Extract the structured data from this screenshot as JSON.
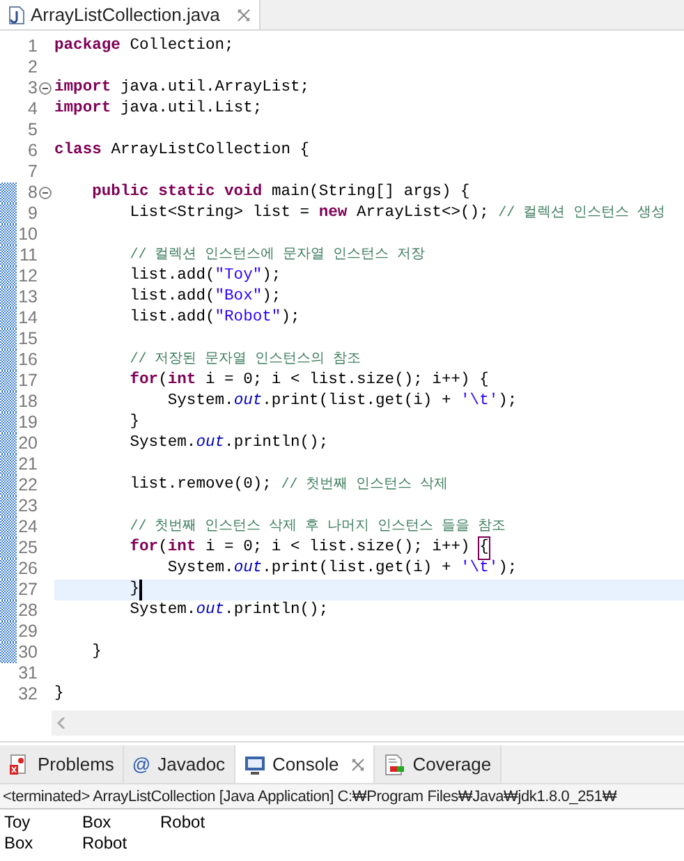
{
  "editor_tab": {
    "title": "ArrayListCollection.java",
    "selected": true
  },
  "lines": [
    {
      "number": "1",
      "fold": false,
      "changed": false,
      "current": false,
      "segments": [
        {
          "kind": "kw",
          "text": "package "
        },
        {
          "kind": "txt",
          "text": "Collection;"
        }
      ]
    },
    {
      "number": "2",
      "fold": false,
      "changed": false,
      "current": false
    },
    {
      "number": "3",
      "fold": true,
      "changed": false,
      "current": false,
      "segments": [
        {
          "kind": "kw",
          "text": "import "
        },
        {
          "kind": "txt",
          "text": "java.util.ArrayList;"
        }
      ]
    },
    {
      "number": "4",
      "fold": false,
      "changed": false,
      "current": false,
      "segments": [
        {
          "kind": "kw",
          "text": "import "
        },
        {
          "kind": "txt",
          "text": "java.util.List;"
        }
      ]
    },
    {
      "number": "5",
      "fold": false,
      "changed": false,
      "current": false
    },
    {
      "number": "6",
      "fold": false,
      "changed": false,
      "current": false,
      "segments": [
        {
          "kind": "kw",
          "text": "class "
        },
        {
          "kind": "txt",
          "text": "ArrayListCollection {"
        }
      ]
    },
    {
      "number": "7",
      "fold": false,
      "changed": false,
      "current": false
    },
    {
      "number": "8",
      "fold": true,
      "changed": true,
      "current": false,
      "segments": [
        {
          "kind": "kw",
          "text": "    public static void "
        },
        {
          "kind": "txt",
          "text": "main(String[] args) {"
        }
      ]
    },
    {
      "number": "9",
      "fold": false,
      "changed": true,
      "current": false,
      "segments": [
        {
          "kind": "txt",
          "text": "        List<String> list = "
        },
        {
          "kind": "kw",
          "text": "new "
        },
        {
          "kind": "txt",
          "text": "ArrayList<>(); "
        },
        {
          "kind": "com",
          "text": "// 컬렉션 인스턴스 생성"
        }
      ]
    },
    {
      "number": "10",
      "fold": false,
      "changed": true,
      "current": false
    },
    {
      "number": "11",
      "fold": false,
      "changed": true,
      "current": false,
      "segments": [
        {
          "kind": "com",
          "text": "        // 컬렉션 인스턴스에 문자열 인스턴스 저장"
        }
      ]
    },
    {
      "number": "12",
      "fold": false,
      "changed": true,
      "current": false,
      "segments": [
        {
          "kind": "txt",
          "text": "        list.add("
        },
        {
          "kind": "str",
          "text": "\"Toy\""
        },
        {
          "kind": "txt",
          "text": ");"
        }
      ]
    },
    {
      "number": "13",
      "fold": false,
      "changed": true,
      "current": false,
      "segments": [
        {
          "kind": "txt",
          "text": "        list.add("
        },
        {
          "kind": "str",
          "text": "\"Box\""
        },
        {
          "kind": "txt",
          "text": ");"
        }
      ]
    },
    {
      "number": "14",
      "fold": false,
      "changed": true,
      "current": false,
      "segments": [
        {
          "kind": "txt",
          "text": "        list.add("
        },
        {
          "kind": "str",
          "text": "\"Robot\""
        },
        {
          "kind": "txt",
          "text": ");"
        }
      ]
    },
    {
      "number": "15",
      "fold": false,
      "changed": true,
      "current": false
    },
    {
      "number": "16",
      "fold": false,
      "changed": true,
      "current": false,
      "segments": [
        {
          "kind": "com",
          "text": "        // 저장된 문자열 인스턴스의 참조"
        }
      ]
    },
    {
      "number": "17",
      "fold": false,
      "changed": true,
      "current": false,
      "segments": [
        {
          "kind": "kw",
          "text": "        for"
        },
        {
          "kind": "txt",
          "text": "("
        },
        {
          "kind": "kw",
          "text": "int"
        },
        {
          "kind": "txt",
          "text": " i = 0; i < list.size(); i++) {"
        }
      ]
    },
    {
      "number": "18",
      "fold": false,
      "changed": true,
      "current": false,
      "segments": [
        {
          "kind": "txt",
          "text": "            System."
        },
        {
          "kind": "fld",
          "text": "out"
        },
        {
          "kind": "txt",
          "text": ".print(list.get(i) + "
        },
        {
          "kind": "str",
          "text": "'\\t'"
        },
        {
          "kind": "txt",
          "text": ");"
        }
      ]
    },
    {
      "number": "19",
      "fold": false,
      "changed": true,
      "current": false,
      "segments": [
        {
          "kind": "txt",
          "text": "        }"
        }
      ]
    },
    {
      "number": "20",
      "fold": false,
      "changed": true,
      "current": false,
      "segments": [
        {
          "kind": "txt",
          "text": "        System."
        },
        {
          "kind": "fld",
          "text": "out"
        },
        {
          "kind": "txt",
          "text": ".println();"
        }
      ]
    },
    {
      "number": "21",
      "fold": false,
      "changed": true,
      "current": false
    },
    {
      "number": "22",
      "fold": false,
      "changed": true,
      "current": false,
      "segments": [
        {
          "kind": "txt",
          "text": "        list.remove(0); "
        },
        {
          "kind": "com",
          "text": "// 첫번째 인스턴스 삭제"
        }
      ]
    },
    {
      "number": "23",
      "fold": false,
      "changed": true,
      "current": false
    },
    {
      "number": "24",
      "fold": false,
      "changed": true,
      "current": false,
      "segments": [
        {
          "kind": "com",
          "text": "        // 첫번째 인스턴스 삭제 후 나머지 인스턴스 들을 참조"
        }
      ]
    },
    {
      "number": "25",
      "fold": false,
      "changed": true,
      "current": false,
      "segments": [
        {
          "kind": "kw",
          "text": "        for"
        },
        {
          "kind": "txt",
          "text": "("
        },
        {
          "kind": "kw",
          "text": "int"
        },
        {
          "kind": "txt",
          "text": " i = 0; i < list.size(); i++) "
        },
        {
          "kind": "match",
          "text": "{"
        }
      ]
    },
    {
      "number": "26",
      "fold": false,
      "changed": true,
      "current": false,
      "segments": [
        {
          "kind": "txt",
          "text": "            System."
        },
        {
          "kind": "fld",
          "text": "out"
        },
        {
          "kind": "txt",
          "text": ".print(list.get(i) + "
        },
        {
          "kind": "str",
          "text": "'\\t'"
        },
        {
          "kind": "txt",
          "text": ");"
        }
      ]
    },
    {
      "number": "27",
      "fold": false,
      "changed": true,
      "current": true,
      "segments": [
        {
          "kind": "txt",
          "text": "        }"
        }
      ]
    },
    {
      "number": "28",
      "fold": false,
      "changed": true,
      "current": false,
      "segments": [
        {
          "kind": "txt",
          "text": "        System."
        },
        {
          "kind": "fld",
          "text": "out"
        },
        {
          "kind": "txt",
          "text": ".println();"
        }
      ]
    },
    {
      "number": "29",
      "fold": false,
      "changed": true,
      "current": false
    },
    {
      "number": "30",
      "fold": false,
      "changed": true,
      "current": false,
      "segments": [
        {
          "kind": "txt",
          "text": "    }"
        }
      ]
    },
    {
      "number": "31",
      "fold": false,
      "changed": false,
      "current": false
    },
    {
      "number": "32",
      "fold": false,
      "changed": false,
      "current": false,
      "segments": [
        {
          "kind": "txt",
          "text": "}"
        }
      ]
    }
  ],
  "bottom_tabs": [
    {
      "kind": "problems",
      "label": "Problems",
      "selected": false,
      "closable": false
    },
    {
      "kind": "javadoc",
      "icon_text": "@",
      "label": "Javadoc",
      "selected": false,
      "closable": false
    },
    {
      "kind": "console",
      "label": "Console",
      "selected": true,
      "closable": true
    },
    {
      "kind": "coverage",
      "label": "Coverage",
      "selected": false,
      "closable": false
    }
  ],
  "console": {
    "header": "<terminated> ArrayListCollection [Java Application] C:₩Program Files₩Java₩jdk1.8.0_251₩",
    "output": [
      [
        "Toy",
        "Box",
        "Robot"
      ],
      [
        "Box",
        "Robot"
      ]
    ]
  }
}
